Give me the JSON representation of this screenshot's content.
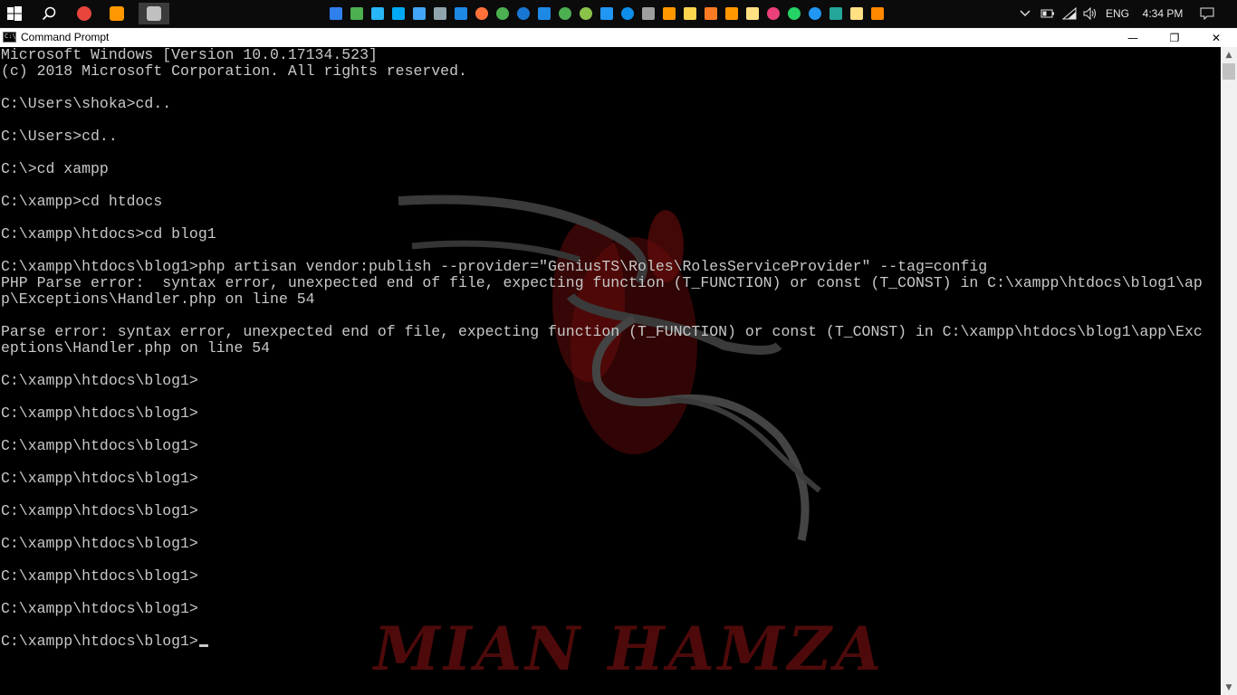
{
  "taskbar": {
    "start_icon": "windows-logo-icon",
    "search_icon": "search-icon",
    "pinned_apps": [
      {
        "name": "chrome-icon",
        "color": "#e8453c"
      },
      {
        "name": "sublime-text-icon",
        "color": "#ff9800"
      },
      {
        "name": "command-prompt-icon",
        "color": "#c0c0c0"
      }
    ],
    "tray_icons": [
      {
        "name": "onedrive-icon",
        "color": "#2f80ed"
      },
      {
        "name": "people-icon",
        "color": "#4caf50"
      },
      {
        "name": "desktop-icon",
        "color": "#29b6f6"
      },
      {
        "name": "network-share-icon",
        "color": "#03a9f4"
      },
      {
        "name": "control-panel-icon",
        "color": "#42a5f5"
      },
      {
        "name": "recycle-bin-icon",
        "color": "#90a4ae"
      },
      {
        "name": "display-icon",
        "color": "#1e88e5"
      },
      {
        "name": "firefox-icon",
        "color": "#ff7139"
      },
      {
        "name": "chrome-icon",
        "color": "#4caf50"
      },
      {
        "name": "edge-icon",
        "color": "#1976d2"
      },
      {
        "name": "settings-icon",
        "color": "#1e88e5"
      },
      {
        "name": "utorrent-icon",
        "color": "#4caf50"
      },
      {
        "name": "download-icon",
        "color": "#8bc34a"
      },
      {
        "name": "cloud-icon",
        "color": "#2196f3"
      },
      {
        "name": "teamviewer-icon",
        "color": "#0e8ee9"
      },
      {
        "name": "netbeans-icon",
        "color": "#9e9e9e"
      },
      {
        "name": "sublime-text-icon",
        "color": "#ff9800"
      },
      {
        "name": "folder-icon",
        "color": "#ffd54f"
      },
      {
        "name": "xampp-icon",
        "color": "#fb7a24"
      },
      {
        "name": "paint-icon",
        "color": "#ff9800"
      },
      {
        "name": "notes-icon",
        "color": "#ffe082"
      },
      {
        "name": "itunes-icon",
        "color": "#ec407a"
      },
      {
        "name": "whatsapp-icon",
        "color": "#25d366"
      },
      {
        "name": "teamviewer-icon",
        "color": "#2196f3"
      },
      {
        "name": "filezilla-icon",
        "color": "#26a69a"
      },
      {
        "name": "notepad-icon",
        "color": "#ffe082"
      },
      {
        "name": "vlc-icon",
        "color": "#ff8800"
      }
    ],
    "system_tray": {
      "chevron_icon": "chevron-up-icon",
      "battery_icon": "battery-icon",
      "wifi_icon": "wifi-icon",
      "volume_icon": "volume-icon",
      "language": "ENG",
      "time": "4:34 PM",
      "notifications_icon": "notifications-icon"
    }
  },
  "window": {
    "title": "Command Prompt",
    "app_icon": "command-prompt-icon",
    "minimize_glyph": "—",
    "maximize_glyph": "❐",
    "close_glyph": "✕"
  },
  "console": {
    "text_color": "#c8c8c8",
    "lines": [
      "Microsoft Windows [Version 10.0.17134.523]",
      "(c) 2018 Microsoft Corporation. All rights reserved.",
      "",
      "C:\\Users\\shoka>cd..",
      "",
      "C:\\Users>cd..",
      "",
      "C:\\>cd xampp",
      "",
      "C:\\xampp>cd htdocs",
      "",
      "C:\\xampp\\htdocs>cd blog1",
      "",
      "C:\\xampp\\htdocs\\blog1>php artisan vendor:publish --provider=\"GeniusTS\\Roles\\RolesServiceProvider\" --tag=config",
      "PHP Parse error:  syntax error, unexpected end of file, expecting function (T_FUNCTION) or const (T_CONST) in C:\\xampp\\htdocs\\blog1\\ap",
      "p\\Exceptions\\Handler.php on line 54",
      "",
      "Parse error: syntax error, unexpected end of file, expecting function (T_FUNCTION) or const (T_CONST) in C:\\xampp\\htdocs\\blog1\\app\\Exc",
      "eptions\\Handler.php on line 54",
      "",
      "C:\\xampp\\htdocs\\blog1>",
      "",
      "C:\\xampp\\htdocs\\blog1>",
      "",
      "C:\\xampp\\htdocs\\blog1>",
      "",
      "C:\\xampp\\htdocs\\blog1>",
      "",
      "C:\\xampp\\htdocs\\blog1>",
      "",
      "C:\\xampp\\htdocs\\blog1>",
      "",
      "C:\\xampp\\htdocs\\blog1>",
      "",
      "C:\\xampp\\htdocs\\blog1>",
      "",
      "C:\\xampp\\htdocs\\blog1>"
    ],
    "wallpaper_text": "MIAN HAMZA",
    "wallpaper_logo": "kali-dragon-logo"
  },
  "scrollbar": {
    "up_glyph": "▲",
    "down_glyph": "▼"
  }
}
